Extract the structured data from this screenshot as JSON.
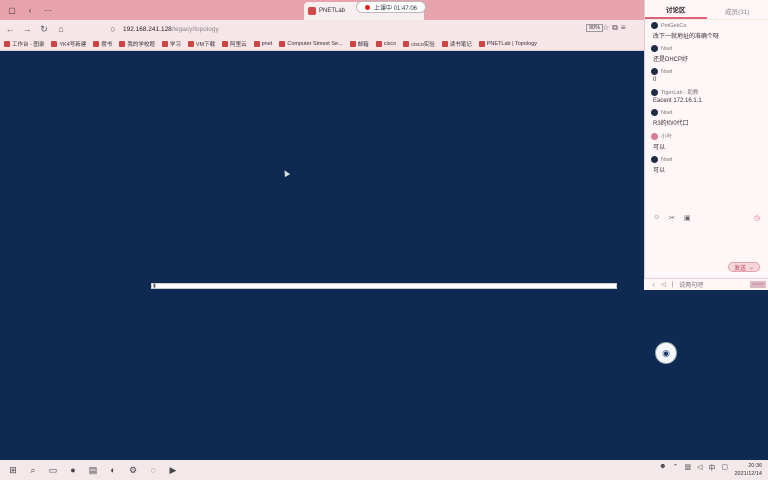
{
  "browser": {
    "tab_title": "PNETLab",
    "recording_status": "上课中 01:47:06",
    "address_host": "192.168.241.128",
    "address_path": "/legacy/topology",
    "zoom_level": "90%"
  },
  "bookmarks": [
    {
      "label": "工作台 - 图录"
    },
    {
      "label": "YK4号新建"
    },
    {
      "label": "攒书"
    },
    {
      "label": "我的学校题"
    },
    {
      "label": "学习"
    },
    {
      "label": "VM下载"
    },
    {
      "label": "阿里云"
    },
    {
      "label": "pnet"
    },
    {
      "label": "Computer Simest Se..."
    },
    {
      "label": "邮箱"
    },
    {
      "label": "cisco"
    },
    {
      "label": "cisco实验"
    },
    {
      "label": "读书笔记"
    },
    {
      "label": "PNETLab | Topology"
    }
  ],
  "panel": {
    "tab_discussion": "讨论区",
    "tab_members": "成员(31)",
    "messages": [
      {
        "user": "PetGekCo",
        "text": "改下一就地址的准确个呀",
        "pink": false
      },
      {
        "user": "Nset",
        "text": "还是DHCP好",
        "pink": false
      },
      {
        "user": "Nset",
        "text": "0",
        "pink": false
      },
      {
        "user": "TigerLab - 助教",
        "text": "Eacent 172.16.1.1",
        "pink": false
      },
      {
        "user": "Nset",
        "text": "R3的f0/0代口",
        "pink": false
      },
      {
        "user": "小叶",
        "text": "可以",
        "pink": true
      },
      {
        "user": "Nset",
        "text": "可以",
        "pink": false
      }
    ],
    "send_label": "发送",
    "bottom_placeholder": "说两句吧"
  },
  "taskbar": {
    "time": "20:36",
    "date": "2021/12/14"
  }
}
